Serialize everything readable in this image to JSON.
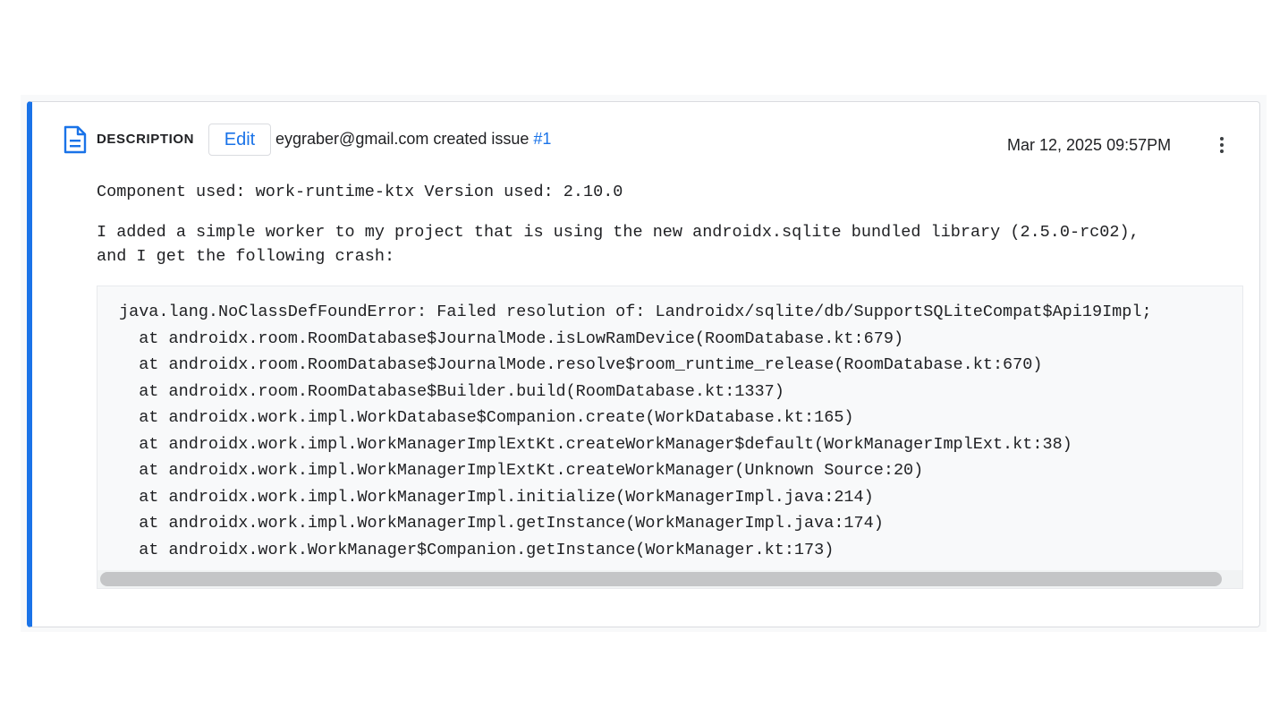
{
  "header": {
    "section_label": "DESCRIPTION",
    "edit_label": "Edit",
    "creator_text": "eygraber@gmail.com created issue ",
    "issue_link": "#1",
    "timestamp": "Mar 12, 2025 09:57PM"
  },
  "body": {
    "component_line": "Component used: work-runtime-ktx Version used: 2.10.0",
    "paragraph": "I added a simple worker to my project that is using the new androidx.sqlite bundled library (2.5.0-rc02),\nand I get the following crash:"
  },
  "stacktrace": {
    "lines": [
      "java.lang.NoClassDefFoundError: Failed resolution of: Landroidx/sqlite/db/SupportSQLiteCompat$Api19Impl;",
      "  at androidx.room.RoomDatabase$JournalMode.isLowRamDevice(RoomDatabase.kt:679)",
      "  at androidx.room.RoomDatabase$JournalMode.resolve$room_runtime_release(RoomDatabase.kt:670)",
      "  at androidx.room.RoomDatabase$Builder.build(RoomDatabase.kt:1337)",
      "  at androidx.work.impl.WorkDatabase$Companion.create(WorkDatabase.kt:165)",
      "  at androidx.work.impl.WorkManagerImplExtKt.createWorkManager$default(WorkManagerImplExt.kt:38)",
      "  at androidx.work.impl.WorkManagerImplExtKt.createWorkManager(Unknown Source:20)",
      "  at androidx.work.impl.WorkManagerImpl.initialize(WorkManagerImpl.java:214)",
      "  at androidx.work.impl.WorkManagerImpl.getInstance(WorkManagerImpl.java:174)",
      "  at androidx.work.WorkManager$Companion.getInstance(WorkManager.kt:173)"
    ],
    "scroll_fraction_visible": 0.98
  },
  "icons": {
    "document": "document-icon",
    "more": "more-vert-icon"
  },
  "colors": {
    "accent": "#1a73e8",
    "border": "#dadce0",
    "code_bg": "#f8f9fa"
  }
}
